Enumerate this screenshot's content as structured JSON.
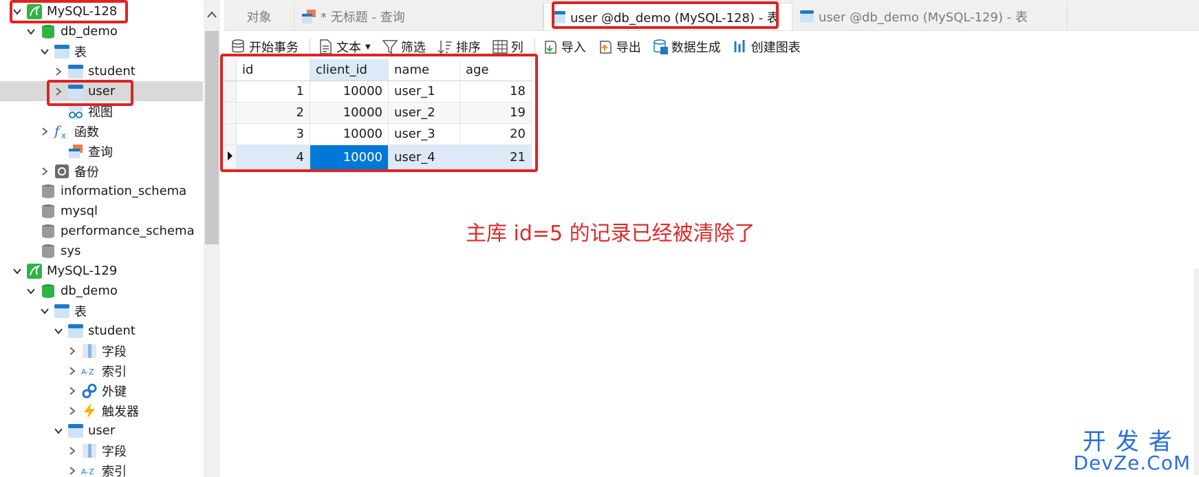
{
  "sidebar": {
    "tree": [
      {
        "label": "MySQL-128",
        "icon": "mysql-connection-icon",
        "chev": "down"
      },
      {
        "label": "db_demo",
        "icon": "database-icon",
        "chev": "down"
      },
      {
        "label": "表",
        "icon": "tables-icon",
        "chev": "down"
      },
      {
        "label": "student",
        "icon": "table-icon",
        "chev": "right"
      },
      {
        "label": "user",
        "icon": "table-icon",
        "chev": "right"
      },
      {
        "label": "视图",
        "icon": "view-icon",
        "chev": ""
      },
      {
        "label": "函数",
        "icon": "function-icon",
        "chev": "right"
      },
      {
        "label": "查询",
        "icon": "query-icon",
        "chev": ""
      },
      {
        "label": "备份",
        "icon": "backup-icon",
        "chev": "right"
      },
      {
        "label": "information_schema",
        "icon": "database-gray-icon",
        "chev": ""
      },
      {
        "label": "mysql",
        "icon": "database-gray-icon",
        "chev": ""
      },
      {
        "label": "performance_schema",
        "icon": "database-gray-icon",
        "chev": ""
      },
      {
        "label": "sys",
        "icon": "database-gray-icon",
        "chev": ""
      },
      {
        "label": "MySQL-129",
        "icon": "mysql-connection-icon",
        "chev": "down"
      },
      {
        "label": "db_demo",
        "icon": "database-icon",
        "chev": "down"
      },
      {
        "label": "表",
        "icon": "tables-icon",
        "chev": "down"
      },
      {
        "label": "student",
        "icon": "table-icon",
        "chev": "down"
      },
      {
        "label": "字段",
        "icon": "fields-icon",
        "chev": "right"
      },
      {
        "label": "索引",
        "icon": "index-icon",
        "chev": "right"
      },
      {
        "label": "外键",
        "icon": "foreign-key-icon",
        "chev": "right"
      },
      {
        "label": "触发器",
        "icon": "trigger-icon",
        "chev": "right"
      },
      {
        "label": "user",
        "icon": "table-icon",
        "chev": "down"
      },
      {
        "label": "字段",
        "icon": "fields-icon",
        "chev": "right"
      },
      {
        "label": "索引",
        "icon": "index-icon",
        "chev": "right"
      }
    ]
  },
  "tabs": [
    {
      "label": "对象"
    },
    {
      "label": "* 无标题 - 查询"
    },
    {
      "label": "user @db_demo (MySQL-128) - 表"
    },
    {
      "label": "user @db_demo (MySQL-129) - 表"
    }
  ],
  "toolbar": {
    "begin_transaction": "开始事务",
    "text": "文本",
    "filter": "筛选",
    "sort": "排序",
    "columns": "列",
    "import": "导入",
    "export": "导出",
    "data_gen": "数据生成",
    "create_chart": "创建图表"
  },
  "grid": {
    "columns": [
      "id",
      "client_id",
      "name",
      "age"
    ],
    "rows": [
      [
        "1",
        "10000",
        "user_1",
        "18"
      ],
      [
        "2",
        "10000",
        "user_2",
        "19"
      ],
      [
        "3",
        "10000",
        "user_3",
        "20"
      ],
      [
        "4",
        "10000",
        "user_4",
        "21"
      ]
    ]
  },
  "annotation": "主库 id=5 的记录已经被清除了",
  "watermark": {
    "cn": "开发者",
    "en": "DevZe.CoM"
  },
  "colors": {
    "accent": "#0078d7",
    "annotation_red": "#e02222",
    "watermark_blue": "#2a6fd6"
  }
}
